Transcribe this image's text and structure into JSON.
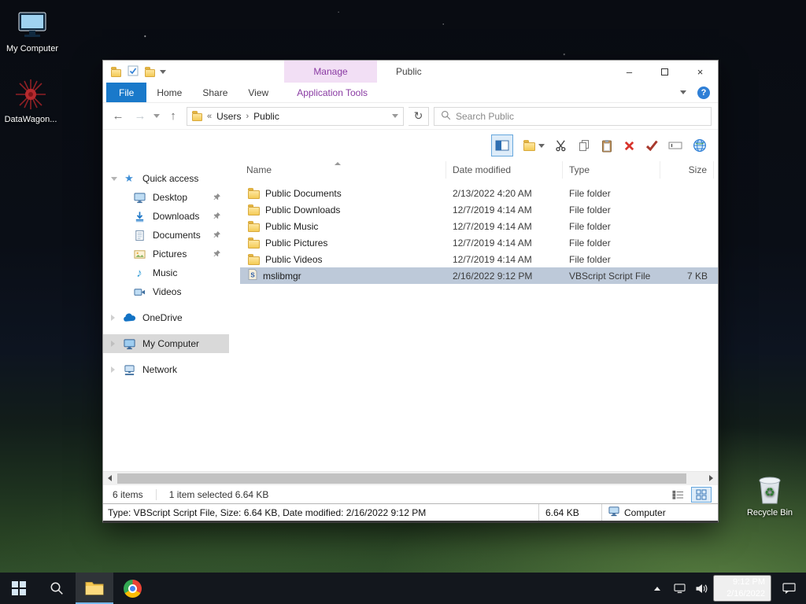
{
  "icons": {
    "back": "←",
    "forward": "→",
    "up": "↑",
    "refresh": "↻",
    "star": "★",
    "music_note": "♪"
  },
  "desktop": {
    "icons": [
      {
        "label": "My Computer"
      },
      {
        "label": "DataWagon..."
      },
      {
        "label": "Recycle Bin"
      }
    ]
  },
  "explorer": {
    "titlebar": {
      "manage_label": "Manage",
      "title": "Public",
      "controls": {
        "minimize": "–",
        "close": "×"
      }
    },
    "ribbon": {
      "file_tab": "File",
      "tabs": [
        "Home",
        "Share",
        "View"
      ],
      "contextual_tab": "Application Tools",
      "help_glyph": "?"
    },
    "navbar": {
      "address": {
        "overflow": "«",
        "sep": "›",
        "crumbs": [
          "Users",
          "Public"
        ]
      },
      "search_placeholder": "Search Public"
    },
    "sidebar": {
      "items": [
        {
          "label": "Quick access"
        },
        {
          "label": "Desktop"
        },
        {
          "label": "Downloads"
        },
        {
          "label": "Documents"
        },
        {
          "label": "Pictures"
        },
        {
          "label": "Music"
        },
        {
          "label": "Videos"
        },
        {
          "label": "OneDrive"
        },
        {
          "label": "My Computer"
        },
        {
          "label": "Network"
        }
      ]
    },
    "filelist": {
      "columns": [
        "Name",
        "Date modified",
        "Type",
        "Size"
      ],
      "rows": [
        {
          "name": "Public Documents",
          "date_modified": "2/13/2022 4:20 AM",
          "type": "File folder",
          "size": ""
        },
        {
          "name": "Public Downloads",
          "date_modified": "12/7/2019 4:14 AM",
          "type": "File folder",
          "size": ""
        },
        {
          "name": "Public Music",
          "date_modified": "12/7/2019 4:14 AM",
          "type": "File folder",
          "size": ""
        },
        {
          "name": "Public Pictures",
          "date_modified": "12/7/2019 4:14 AM",
          "type": "File folder",
          "size": ""
        },
        {
          "name": "Public Videos",
          "date_modified": "12/7/2019 4:14 AM",
          "type": "File folder",
          "size": ""
        },
        {
          "name": "mslibmgr",
          "date_modified": "2/16/2022 9:12 PM",
          "type": "VBScript Script File",
          "size": "7 KB"
        }
      ]
    },
    "statusbar": {
      "item_count": "6 items",
      "selection_info": "1 item selected 6.64 KB"
    },
    "details_bar": {
      "summary": "Type: VBScript Script File, Size: 6.64 KB, Date modified: 2/16/2022 9:12 PM",
      "size": "6.64 KB",
      "zone": "Computer"
    }
  },
  "taskbar": {
    "clock": {
      "time": "9:12 PM",
      "date": "2/16/2022"
    }
  }
}
